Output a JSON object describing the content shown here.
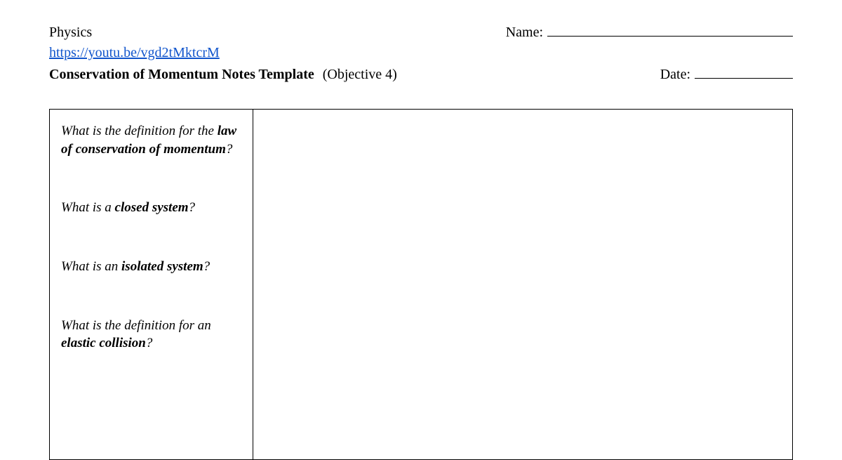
{
  "header": {
    "subject": "Physics",
    "name_label": "Name:",
    "link_text": "https://youtu.be/vgd2tMktcrM",
    "title": "Conservation of Momentum Notes Template",
    "objective": "(Objective 4)",
    "date_label": "Date:"
  },
  "questions": {
    "q1_pre": "What is the definition for the ",
    "q1_bold": "law of conservation of momentum",
    "q1_post": "?",
    "q2_pre": "What is a ",
    "q2_bold": "closed system",
    "q2_post": "?",
    "q3_pre": "What is an ",
    "q3_bold": "isolated system",
    "q3_post": "?",
    "q4_pre": "What is the definition for an ",
    "q4_bold": "elastic collision",
    "q4_post": "?"
  }
}
